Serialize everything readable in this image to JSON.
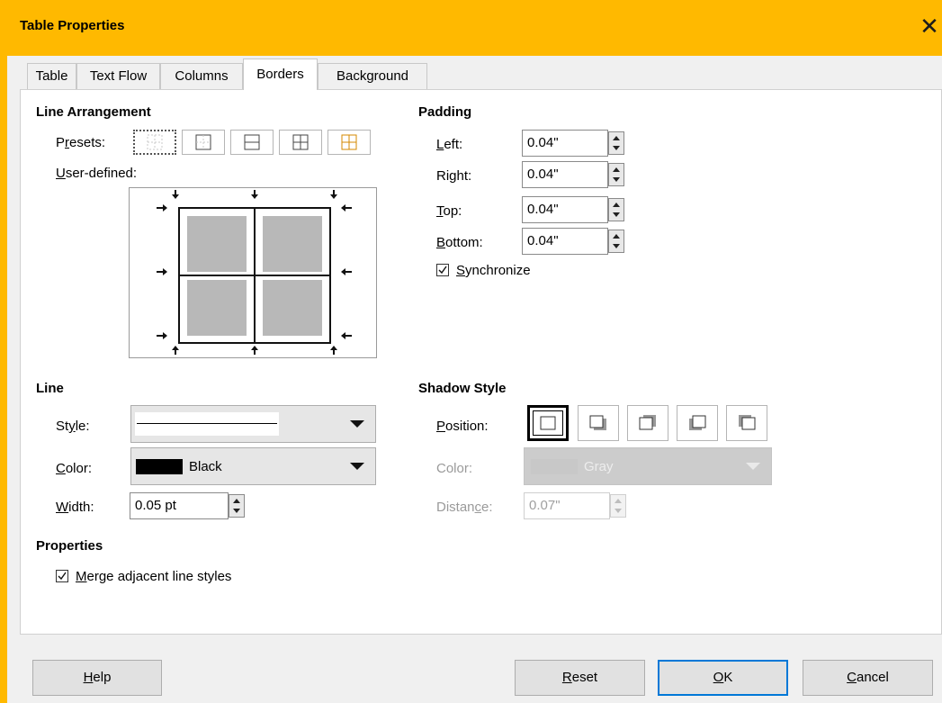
{
  "window": {
    "title": "Table Properties",
    "close_glyph": "✕"
  },
  "tabs": [
    {
      "label": "Table"
    },
    {
      "label": "Text Flow"
    },
    {
      "label": "Columns"
    },
    {
      "label": "Borders",
      "active": true
    },
    {
      "label": "Background"
    }
  ],
  "line_arrangement": {
    "heading": "Line Arrangement",
    "presets_label_pre": "P",
    "presets_label_u": "r",
    "presets_label_post": "esets:",
    "presets": [
      "none-icon",
      "outer-border-only-icon",
      "outer-and-horizontal-icon",
      "outer-and-all-inner-icon",
      "outer-without-changing-inner-icon"
    ],
    "user_defined_label_u": "U",
    "user_defined_label_post": "ser-defined:"
  },
  "padding": {
    "heading": "Padding",
    "left": {
      "u": "L",
      "rest": "eft:",
      "value": "0.04\""
    },
    "right": {
      "pre": "Ri",
      "u": "g",
      "rest": "ht:",
      "value": "0.04\""
    },
    "top": {
      "u": "T",
      "rest": "op:",
      "value": "0.04\""
    },
    "bottom": {
      "u": "B",
      "rest": "ottom:",
      "value": "0.04\""
    },
    "synchronize": {
      "u": "S",
      "rest": "ynchronize",
      "checked": true
    }
  },
  "line": {
    "heading": "Line",
    "style_label": {
      "pre": "St",
      "u": "y",
      "rest": "le:"
    },
    "color_label": {
      "u": "C",
      "rest": "olor:"
    },
    "color_value": "Black",
    "color_swatch": "#000000",
    "width_label": {
      "u": "W",
      "rest": "idth:"
    },
    "width_value": "0.05 pt"
  },
  "shadow_style": {
    "heading": "Shadow Style",
    "position_label": {
      "u": "P",
      "rest": "osition:"
    },
    "color_label": "Color:",
    "color_value": "Gray",
    "color_swatch": "#c8c8c8",
    "distance_label": {
      "pre": "Distan",
      "u": "c",
      "rest": "e:"
    },
    "distance_value": "0.07\""
  },
  "properties": {
    "heading": "Properties",
    "merge": {
      "u": "M",
      "rest": "erge adjacent line styles",
      "checked": true
    }
  },
  "buttons": {
    "help": {
      "u": "H",
      "rest": "elp"
    },
    "reset": {
      "u": "R",
      "rest": "eset"
    },
    "ok": {
      "u": "O",
      "rest": "K"
    },
    "cancel": {
      "u": "C",
      "rest": "ancel"
    }
  },
  "colors": {
    "titlebar": "#ffb900",
    "default_button_border": "#0078d7"
  }
}
